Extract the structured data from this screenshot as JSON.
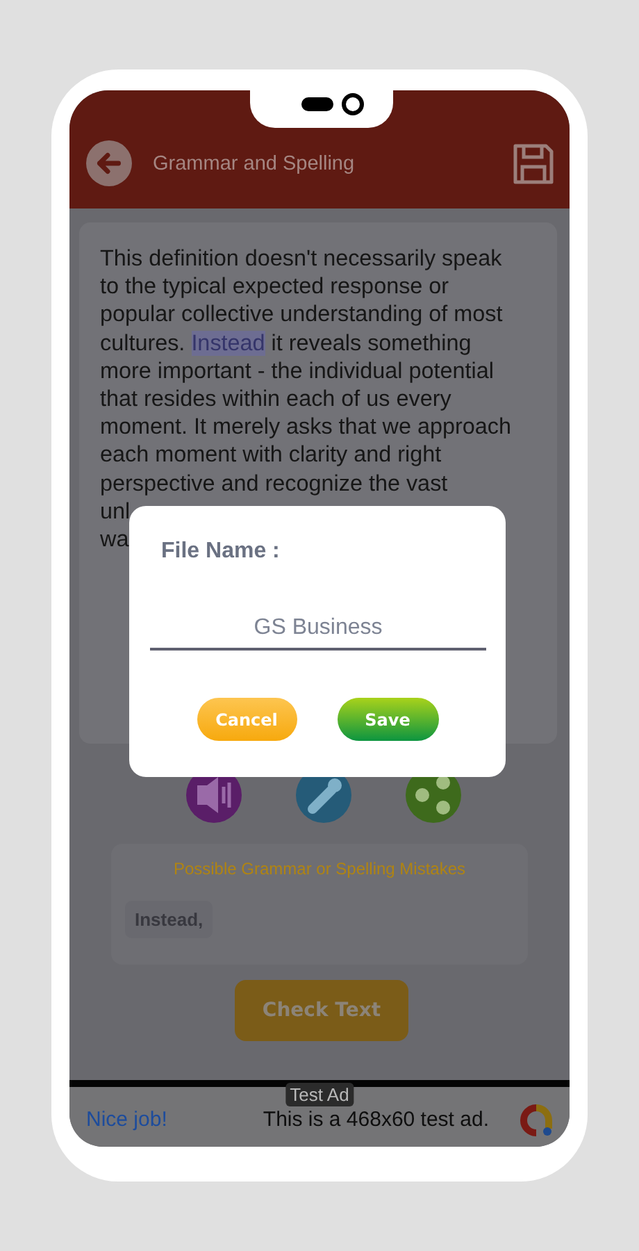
{
  "header": {
    "title": "Grammar and Spelling"
  },
  "editor": {
    "segments": [
      {
        "text": "This definition doesn't necessarily speak\nto the typical expected response or\npopular collective understanding of most\ncultures. ",
        "highlighted": false
      },
      {
        "text": "Instead",
        "highlighted": true
      },
      {
        "text": " it reveals something\nmore important - the individual potential\nthat resides within each of us every\nmoment. It merely asks that we approach\neach moment with clarity and right\nperspective and recognize the vast",
        "highlighted": false
      }
    ],
    "covered_lines": [
      "unl",
      "wa"
    ]
  },
  "mistakes": {
    "title": "Possible Grammar or Spelling Mistakes",
    "items": [
      "Instead,"
    ]
  },
  "check_button": "Check Text",
  "ad": {
    "badge": "Test Ad",
    "headline": "Nice job!",
    "text": "This is a 468x60 test ad."
  },
  "dialog": {
    "label": "File Name :",
    "value": "GS Business",
    "buttons": [
      {
        "kind": "cancel",
        "label": "Cancel"
      },
      {
        "kind": "save",
        "label": "Save"
      }
    ]
  }
}
